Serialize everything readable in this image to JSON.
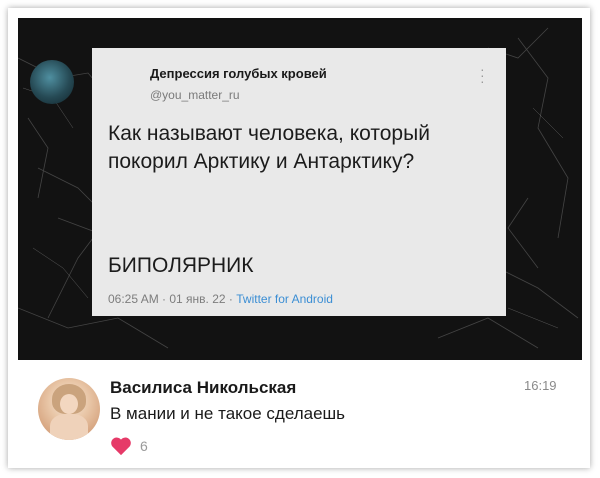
{
  "tweet": {
    "author_name": "Депрессия голубых кровей",
    "handle": "@you_matter_ru",
    "body": "Как называют человека, который покорил Арктику и Антарктику?",
    "answer": "БИПОЛЯРНИК",
    "meta_time": "06:25 AM · 01 янв. 22 · ",
    "meta_source": "Twitter for Android",
    "menu_icon": "vertical-dots-icon"
  },
  "comment": {
    "author_name": "Василиса Никольская",
    "time": "16:19",
    "text": "В мании и не такое сделаешь",
    "like_icon": "heart-icon",
    "like_count": "6",
    "like_color": "#e63a68"
  },
  "colors": {
    "background": "#ffffff",
    "marble": "#121212",
    "tweet_card": "#e9e9e9",
    "link": "#3b8ed4"
  }
}
